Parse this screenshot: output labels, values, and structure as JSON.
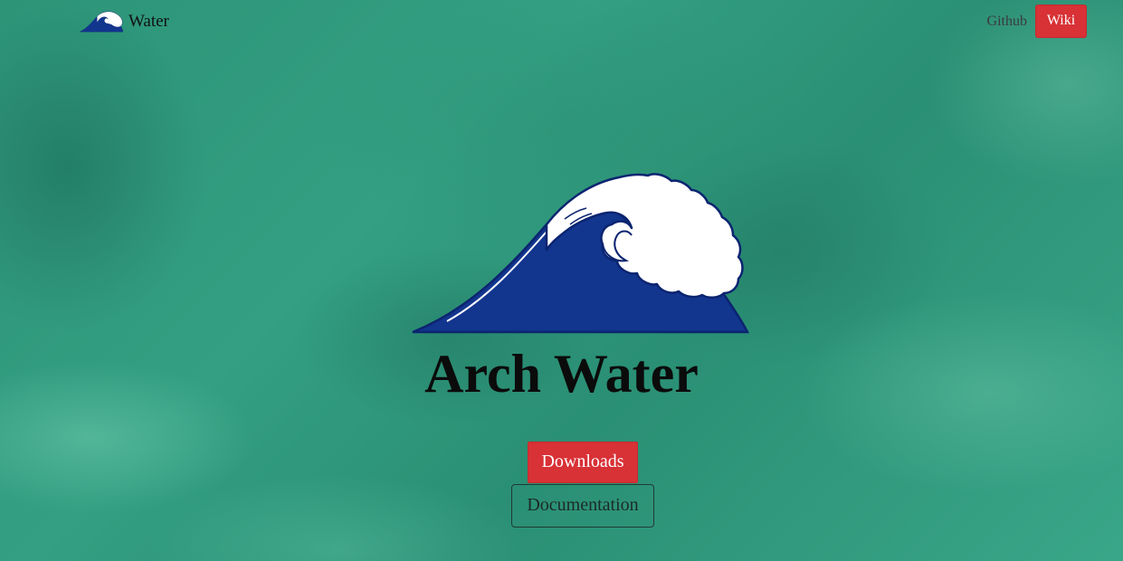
{
  "nav": {
    "brand_label": "Water",
    "links": {
      "github_label": "Github",
      "wiki_label": "Wiki"
    },
    "brand_icon": "wave-logo-icon"
  },
  "hero": {
    "title": "Arch Water",
    "logo_icon": "wave-logo-icon",
    "buttons": {
      "downloads_label": "Downloads",
      "documentation_label": "Documentation"
    }
  },
  "colors": {
    "accent_red": "#d83136",
    "wave_blue": "#12358e",
    "background_teal": "#2f9a7f"
  }
}
